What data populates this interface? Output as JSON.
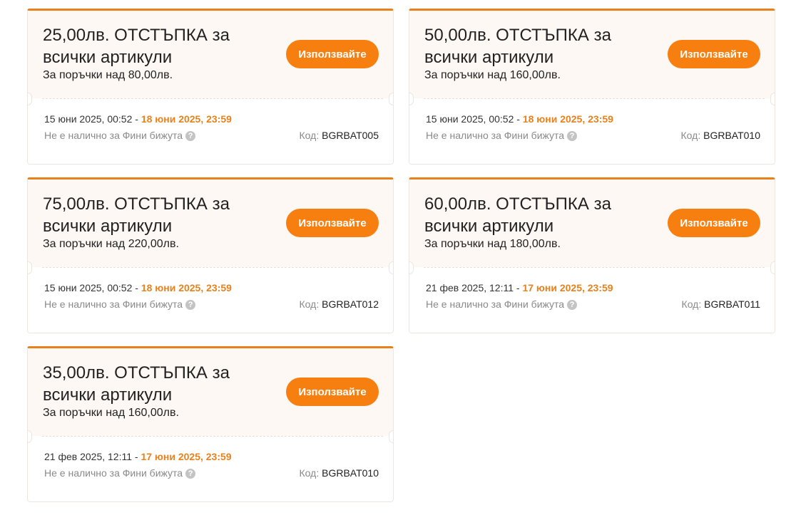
{
  "coupons": [
    {
      "title": "25,00лв. ОТСТЪПКА за всички артикули",
      "condition": "За поръчки над 80,00лв.",
      "button_label": "Използвайте",
      "start": "15 юни 2025, 00:52",
      "separator": " - ",
      "end": "18 юни 2025, 23:59",
      "availability": "Не е налично за Фини бижута",
      "help_glyph": "?",
      "code_label": "Код:",
      "code": "BGRBAT005"
    },
    {
      "title": "50,00лв. ОТСТЪПКА за всички артикули",
      "condition": "За поръчки над 160,00лв.",
      "button_label": "Използвайте",
      "start": "15 юни 2025, 00:52",
      "separator": " - ",
      "end": "18 юни 2025, 23:59",
      "availability": "Не е налично за Фини бижута",
      "help_glyph": "?",
      "code_label": "Код:",
      "code": "BGRBAT010"
    },
    {
      "title": "75,00лв. ОТСТЪПКА за всички артикули",
      "condition": "За поръчки над 220,00лв.",
      "button_label": "Използвайте",
      "start": "15 юни 2025, 00:52",
      "separator": " - ",
      "end": "18 юни 2025, 23:59",
      "availability": "Не е налично за Фини бижута",
      "help_glyph": "?",
      "code_label": "Код:",
      "code": "BGRBAT012"
    },
    {
      "title": "60,00лв. ОТСТЪПКА за всички артикули",
      "condition": "За поръчки над 180,00лв.",
      "button_label": "Използвайте",
      "start": "21 фев 2025, 12:11",
      "separator": " - ",
      "end": "17 юни 2025, 23:59",
      "availability": "Не е налично за Фини бижута",
      "help_glyph": "?",
      "code_label": "Код:",
      "code": "BGRBAT011"
    },
    {
      "title": "35,00лв. ОТСТЪПКА за всички артикули",
      "condition": "За поръчки над 160,00лв.",
      "button_label": "Използвайте",
      "start": "21 фев 2025, 12:11",
      "separator": " - ",
      "end": "17 юни 2025, 23:59",
      "availability": "Не е налично за Фини бижута",
      "help_glyph": "?",
      "code_label": "Код:",
      "code": "BGRBAT010"
    }
  ],
  "colors": {
    "accent": "#e8811c",
    "button": "#f77f0f",
    "card_top": "#fdf8f3"
  },
  "icons": {
    "help": "question-circle-icon"
  }
}
